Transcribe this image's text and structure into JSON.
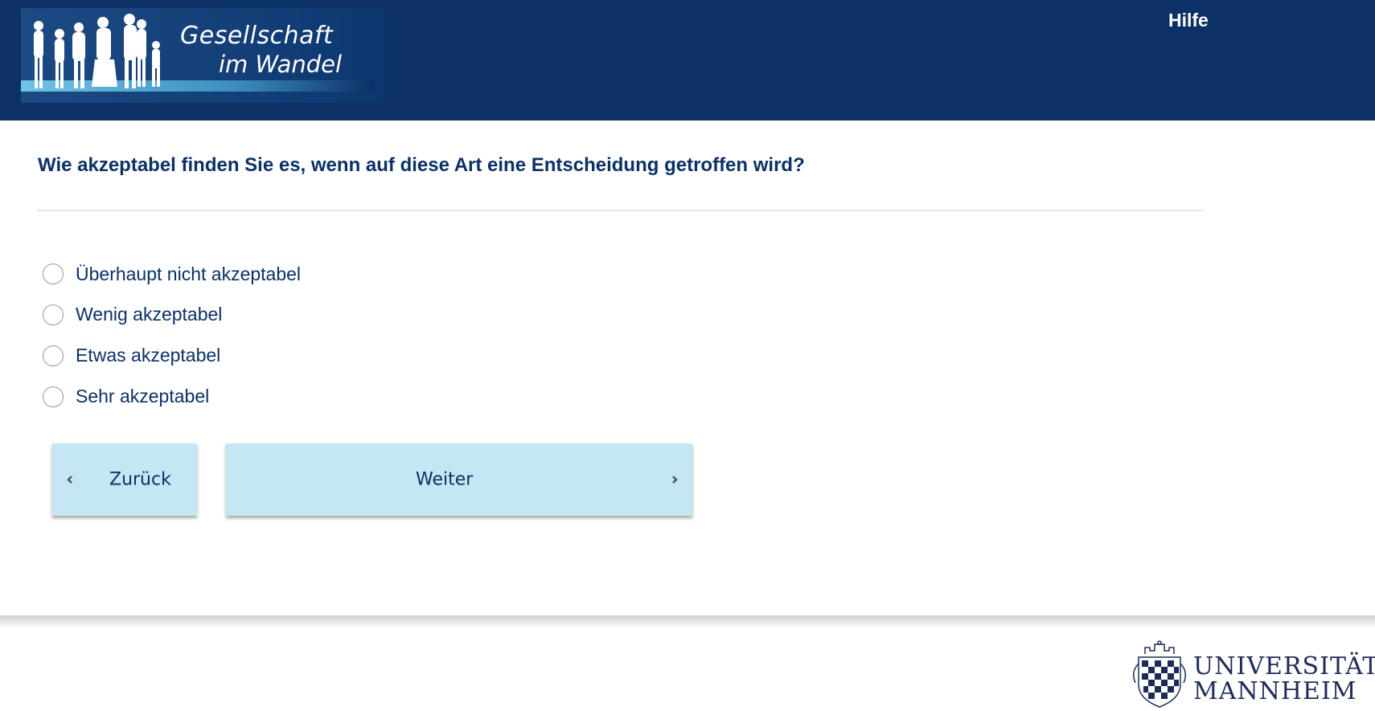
{
  "header": {
    "logo_line1": "Gesellschaft",
    "logo_line2": "im Wandel",
    "help_label": "Hilfe"
  },
  "question": {
    "text": "Wie akzeptabel finden Sie es, wenn auf diese Art eine Entscheidung getroffen wird?"
  },
  "options": [
    {
      "label": "Überhaupt nicht akzeptabel"
    },
    {
      "label": "Wenig akzeptabel"
    },
    {
      "label": "Etwas akzeptabel"
    },
    {
      "label": "Sehr akzeptabel"
    }
  ],
  "nav": {
    "back_label": "Zurück",
    "next_label": "Weiter"
  },
  "footer": {
    "uni_line1": "UNIVERSITÄT",
    "uni_line2": "MANNHEIM"
  },
  "colors": {
    "header_bg": "#0b3166",
    "button_bg": "#c5e6f3",
    "text": "#0b3166"
  }
}
